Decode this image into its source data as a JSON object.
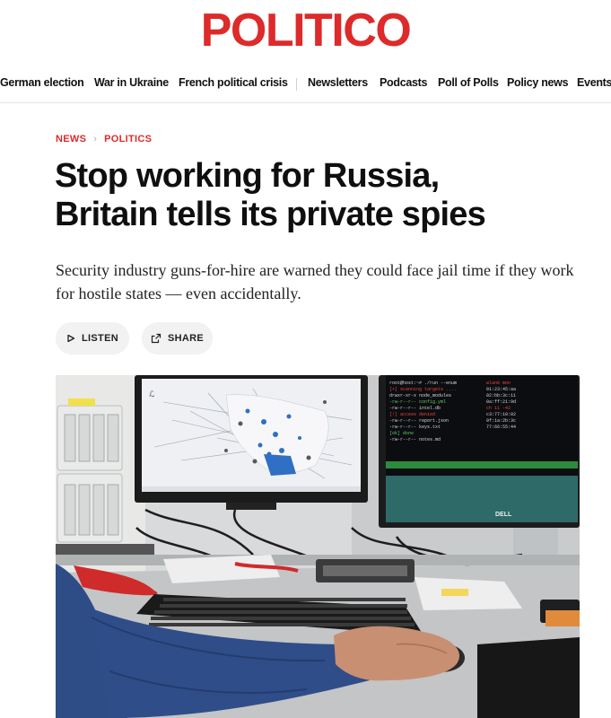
{
  "brand": {
    "logo": "POLITICO",
    "color": "#dd2a2a"
  },
  "nav": {
    "items": [
      {
        "label": "German election"
      },
      {
        "label": "War in Ukraine"
      },
      {
        "label": "French political crisis"
      },
      {
        "label": "Newsletters"
      },
      {
        "label": "Podcasts"
      },
      {
        "label": "Poll of Polls"
      },
      {
        "label": "Policy news"
      },
      {
        "label": "Events"
      }
    ]
  },
  "breadcrumb": {
    "section": "NEWS",
    "subsection": "POLITICS"
  },
  "article": {
    "headline_line1": "Stop working for Russia,",
    "headline_line2": "Britain tells its private spies",
    "dek": "Security industry guns-for-hire are warned they could face jail time if they work for hostile states — even accidentally."
  },
  "actions": {
    "listen": "LISTEN",
    "share": "SHARE"
  },
  "photo": {
    "monitor_label": "DELL"
  }
}
